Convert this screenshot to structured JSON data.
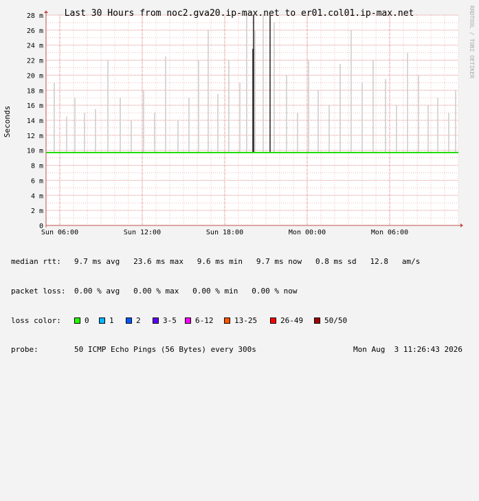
{
  "chart_data": {
    "type": "area",
    "title": "Last 30 Hours from noc2.gva20.ip-max.net to er01.col01.ip-max.net",
    "ylabel": "Seconds",
    "watermark": "RRDTOOL / TOBI OETIKER",
    "ylim": [
      0,
      28
    ],
    "y_unit": "ms",
    "yticks": [
      {
        "v": 0,
        "label": "0"
      },
      {
        "v": 2,
        "label": "2 m"
      },
      {
        "v": 4,
        "label": "4 m"
      },
      {
        "v": 6,
        "label": "6 m"
      },
      {
        "v": 8,
        "label": "8 m"
      },
      {
        "v": 10,
        "label": "10 m"
      },
      {
        "v": 12,
        "label": "12 m"
      },
      {
        "v": 14,
        "label": "14 m"
      },
      {
        "v": 16,
        "label": "16 m"
      },
      {
        "v": 18,
        "label": "18 m"
      },
      {
        "v": 20,
        "label": "20 m"
      },
      {
        "v": 22,
        "label": "22 m"
      },
      {
        "v": 24,
        "label": "24 m"
      },
      {
        "v": 26,
        "label": "26 m"
      },
      {
        "v": 28,
        "label": "28 m"
      }
    ],
    "xlim_hours": [
      0,
      30
    ],
    "xticks": [
      {
        "h": 1,
        "label": "Sun 06:00"
      },
      {
        "h": 7,
        "label": "Sun 12:00"
      },
      {
        "h": 13,
        "label": "Sun 18:00"
      },
      {
        "h": 19,
        "label": "Mon 00:00"
      },
      {
        "h": 25,
        "label": "Mon 06:00"
      }
    ],
    "grid": true,
    "colors": {
      "background": "#f3f3f3",
      "plot_bg": "#ffffff",
      "grid_minor": "#f0bcbc",
      "grid_major": "#e08a8a",
      "axis": "#c0504d",
      "median": "#22dd00",
      "smoke": "#cfcfcf",
      "spike": "#222222"
    },
    "series": [
      {
        "name": "median rtt",
        "median_ms": 9.7
      },
      {
        "spikes": [
          {
            "h": 0.6,
            "v": 19
          },
          {
            "h": 1.5,
            "v": 14.5
          },
          {
            "h": 2.1,
            "v": 17
          },
          {
            "h": 2.8,
            "v": 15
          },
          {
            "h": 3.6,
            "v": 15.5
          },
          {
            "h": 4.5,
            "v": 22
          },
          {
            "h": 5.4,
            "v": 17
          },
          {
            "h": 6.2,
            "v": 14
          },
          {
            "h": 7.1,
            "v": 18
          },
          {
            "h": 7.9,
            "v": 15
          },
          {
            "h": 8.7,
            "v": 22.5
          },
          {
            "h": 9.6,
            "v": 14
          },
          {
            "h": 10.4,
            "v": 17
          },
          {
            "h": 11.1,
            "v": 22
          },
          {
            "h": 11.8,
            "v": 26
          },
          {
            "h": 12.5,
            "v": 17.5
          },
          {
            "h": 13.3,
            "v": 22
          },
          {
            "h": 14.1,
            "v": 19
          },
          {
            "h": 14.6,
            "v": 28
          },
          {
            "h": 15.2,
            "v": 26
          },
          {
            "h": 15.8,
            "v": 28
          },
          {
            "h": 16.6,
            "v": 27
          },
          {
            "h": 17.5,
            "v": 20
          },
          {
            "h": 18.3,
            "v": 15
          },
          {
            "h": 19.1,
            "v": 22
          },
          {
            "h": 19.8,
            "v": 18
          },
          {
            "h": 20.6,
            "v": 16
          },
          {
            "h": 21.4,
            "v": 21.5
          },
          {
            "h": 22.2,
            "v": 26
          },
          {
            "h": 23.0,
            "v": 19
          },
          {
            "h": 23.8,
            "v": 22
          },
          {
            "h": 24.7,
            "v": 19.5
          },
          {
            "h": 25.5,
            "v": 16
          },
          {
            "h": 26.3,
            "v": 23
          },
          {
            "h": 27.1,
            "v": 20
          },
          {
            "h": 27.8,
            "v": 16
          },
          {
            "h": 28.5,
            "v": 17
          },
          {
            "h": 29.3,
            "v": 15
          },
          {
            "h": 29.8,
            "v": 18
          }
        ]
      },
      {
        "dark_spikes": [
          {
            "h": 15.1,
            "v": 28
          },
          {
            "h": 15.05,
            "v": 23.5
          },
          {
            "h": 16.3,
            "v": 28
          }
        ]
      }
    ]
  },
  "stats": {
    "median_label": "median rtt:",
    "median_values": "9.7 ms avg   23.6 ms max   9.6 ms min   9.7 ms now   0.8 ms sd   12.8   am/s",
    "loss_label": "packet loss:",
    "loss_values": "0.00 % avg   0.00 % max   0.00 % min   0.00 % now",
    "color_label": "loss color:",
    "loss_colors": [
      {
        "label": "0",
        "color": "#26ff00"
      },
      {
        "label": "1",
        "color": "#00b8ff"
      },
      {
        "label": "2",
        "color": "#0059ff"
      },
      {
        "label": "3-5",
        "color": "#5e00ff"
      },
      {
        "label": "6-12",
        "color": "#ff00ff"
      },
      {
        "label": "13-25",
        "color": "#ff5500"
      },
      {
        "label": "26-49",
        "color": "#ff0000"
      },
      {
        "label": "50/50",
        "color": "#a00000"
      }
    ],
    "probe_label": "probe:",
    "probe_text": "50 ICMP Echo Pings (56 Bytes) every 300s",
    "timestamp": "Mon Aug  3 11:26:43 2026"
  }
}
